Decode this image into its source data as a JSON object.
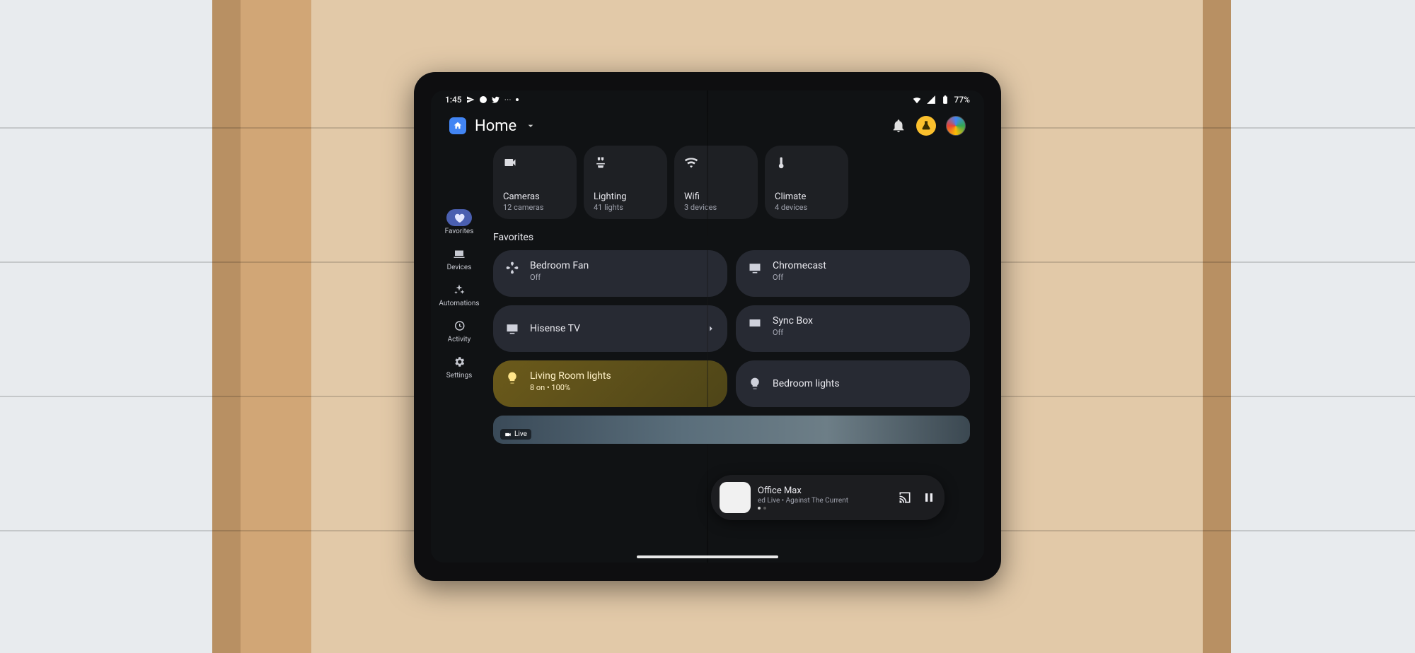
{
  "status": {
    "time": "1:45",
    "battery": "77%"
  },
  "header": {
    "title": "Home"
  },
  "sidebar": [
    {
      "label": "Favorites"
    },
    {
      "label": "Devices"
    },
    {
      "label": "Automations"
    },
    {
      "label": "Activity"
    },
    {
      "label": "Settings"
    }
  ],
  "categories": [
    {
      "label": "Cameras",
      "sub": "12 cameras"
    },
    {
      "label": "Lighting",
      "sub": "41 lights"
    },
    {
      "label": "Wifi",
      "sub": "3 devices"
    },
    {
      "label": "Climate",
      "sub": "4 devices"
    }
  ],
  "favorites_title": "Favorites",
  "devices": [
    {
      "name": "Bedroom Fan",
      "sub": "Off"
    },
    {
      "name": "Chromecast",
      "sub": "Off"
    },
    {
      "name": "Hisense TV",
      "sub": ""
    },
    {
      "name": "Sync Box",
      "sub": "Off"
    },
    {
      "name": "Living Room lights",
      "sub": "8 on • 100%"
    },
    {
      "name": "Bedroom lights",
      "sub": ""
    }
  ],
  "feed": {
    "label": "Live"
  },
  "player": {
    "title": "Office Max",
    "sub": "ed Live • Against The Current"
  }
}
